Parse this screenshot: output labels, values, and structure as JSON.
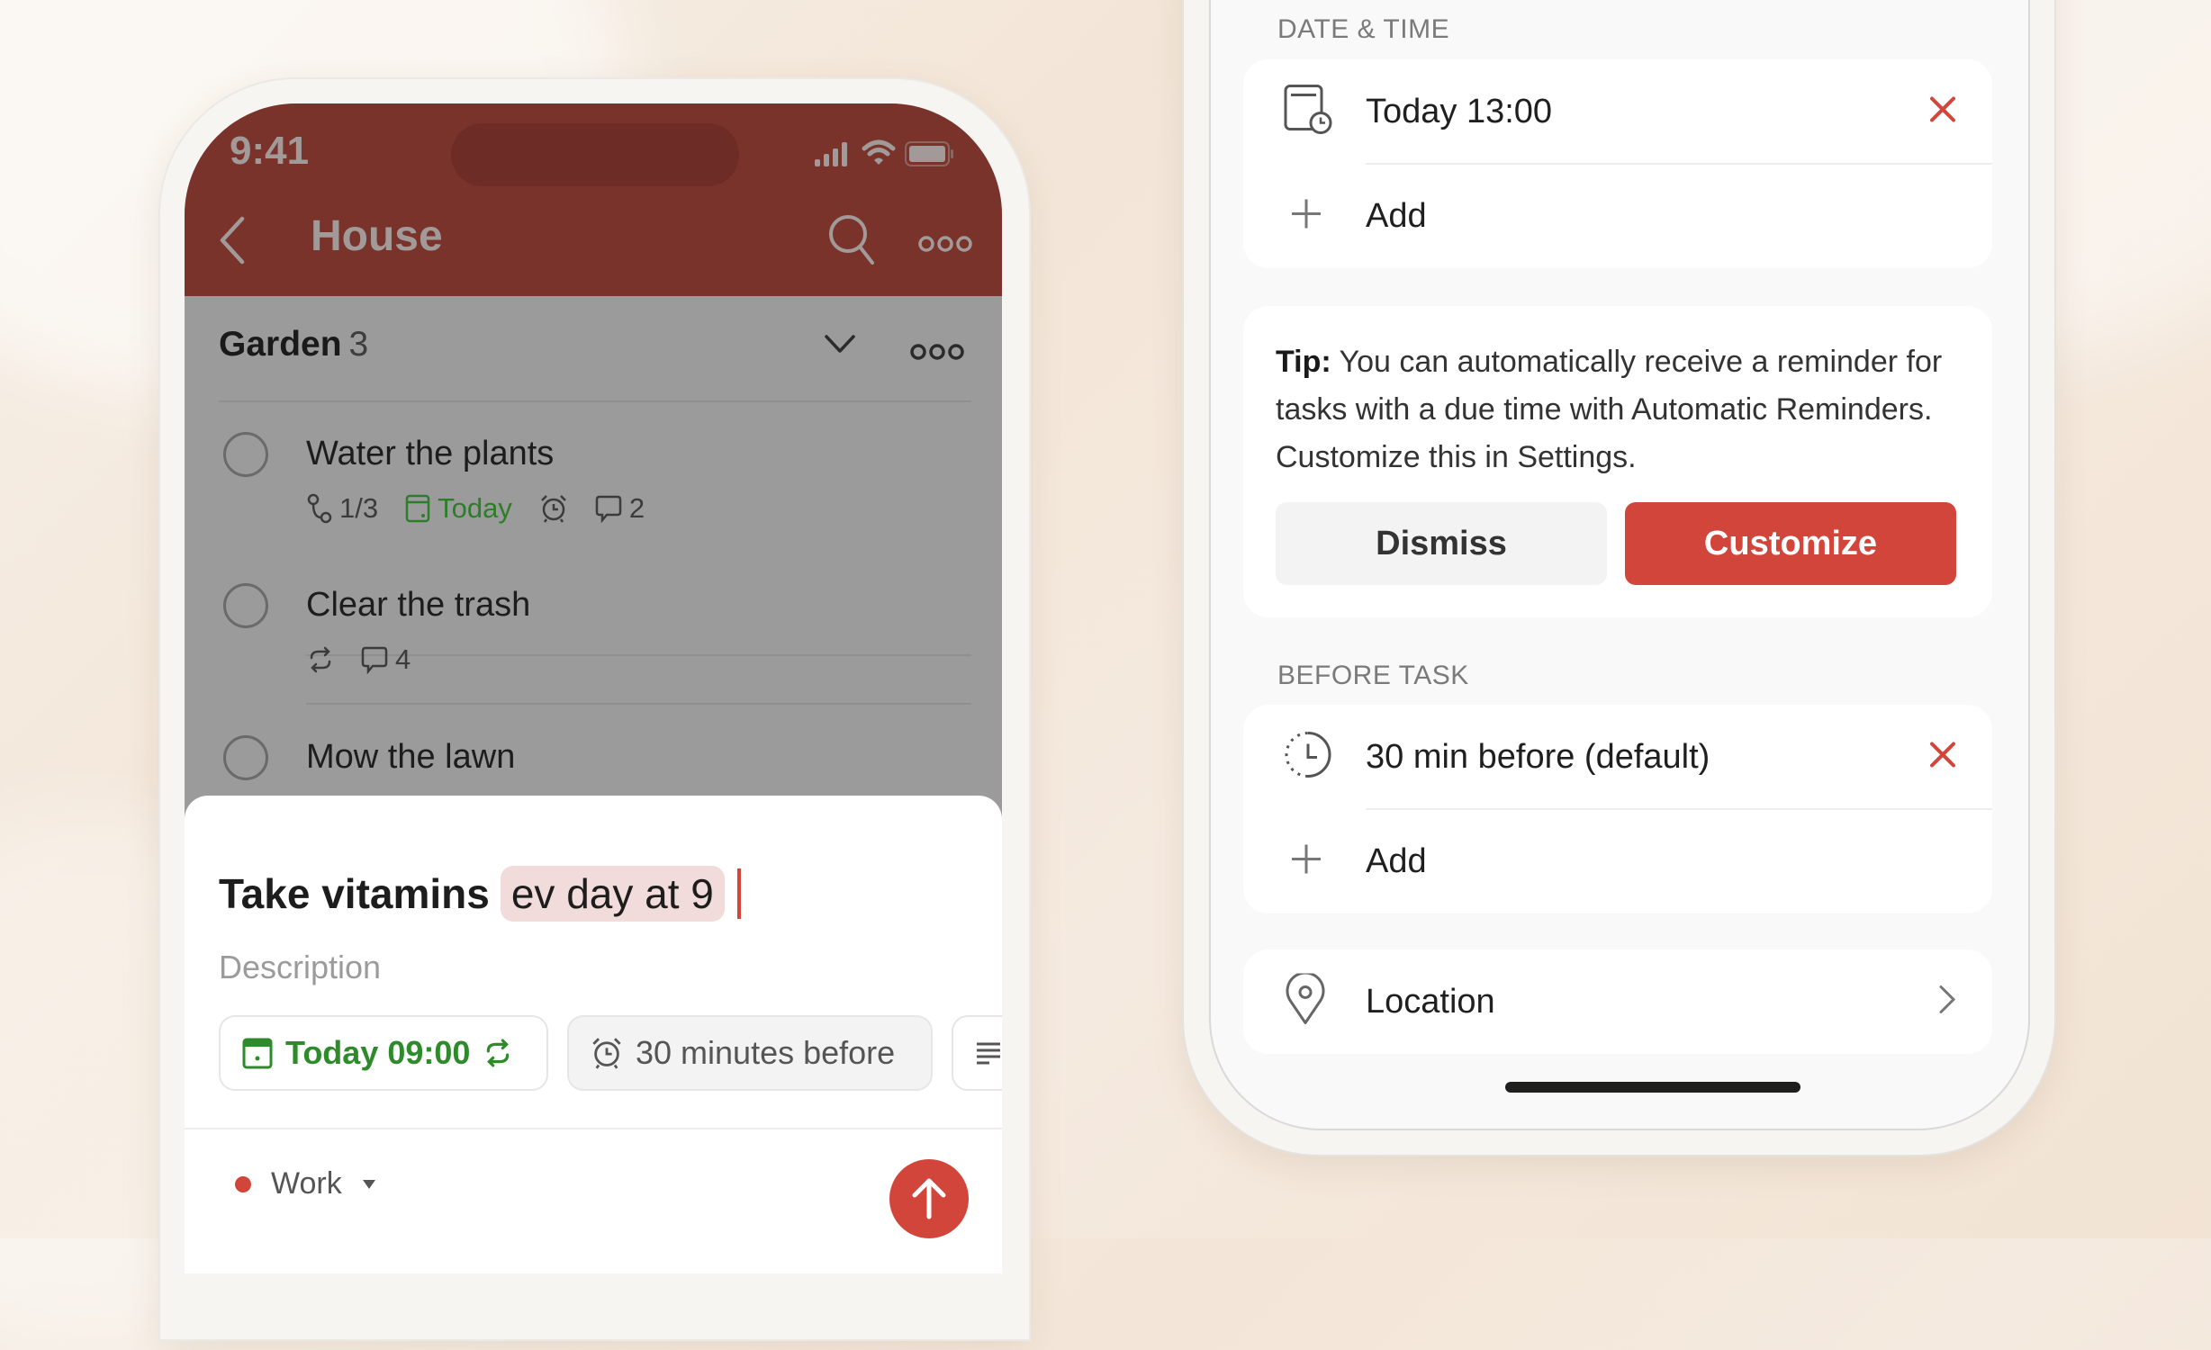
{
  "left_phone": {
    "status_bar": {
      "time": "9:41"
    },
    "header": {
      "title": "House",
      "back_icon": "chevron-left-icon",
      "search_icon": "search-icon",
      "more_icon": "more-icon"
    },
    "section": {
      "name": "Garden",
      "count": "3"
    },
    "tasks": [
      {
        "title": "Water the plants",
        "subtasks": "1/3",
        "due": "Today",
        "has_reminder": true,
        "comments": "2"
      },
      {
        "title": "Clear the trash",
        "recurring": true,
        "comments": "4"
      },
      {
        "title": "Mow the lawn"
      }
    ],
    "quick_add": {
      "title_plain": "Take vitamins",
      "title_highlight": "ev day at 9",
      "description_placeholder": "Description",
      "chips": {
        "date": "Today 09:00",
        "reminder": "30 minutes before"
      },
      "project": "Work"
    },
    "colors": {
      "header": "#7a332b",
      "accent": "#d1453b",
      "green": "#2e8a2a",
      "overlay": "#9b9b9b"
    }
  },
  "right_phone": {
    "date_time": {
      "label": "DATE & TIME",
      "value": "Today 13:00",
      "add_label": "Add"
    },
    "tip": {
      "bold": "Tip:",
      "text": " You can automatically receive a reminder for tasks with a due time with Automatic Reminders. Customize this in Settings.",
      "dismiss_label": "Dismiss",
      "customize_label": "Customize"
    },
    "before_task": {
      "label": "BEFORE TASK",
      "value": "30 min before (default)",
      "add_label": "Add"
    },
    "location": {
      "label": "Location"
    }
  }
}
